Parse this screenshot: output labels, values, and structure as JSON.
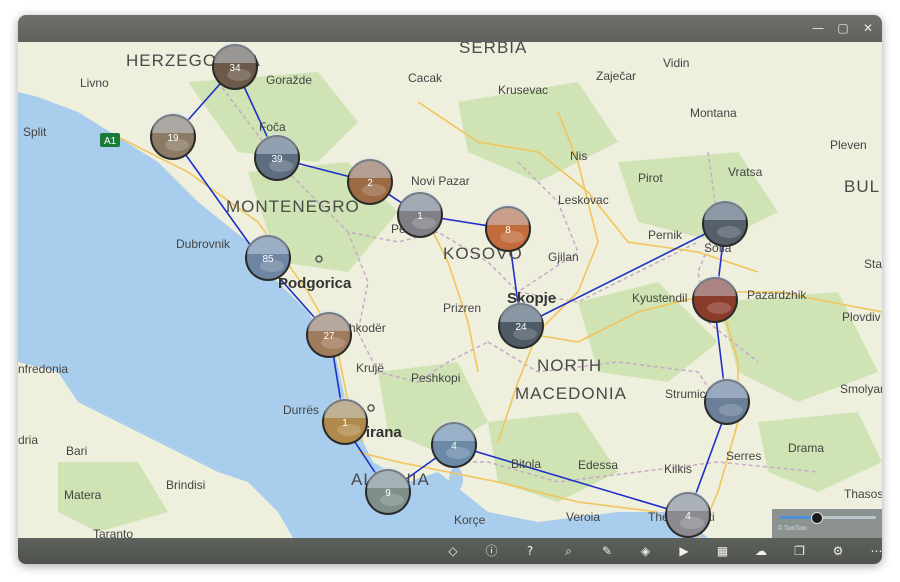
{
  "window": {
    "controls": {
      "minimize": "—",
      "maximize": "▢",
      "close": "✕"
    }
  },
  "map": {
    "countries": [
      {
        "id": "serbia",
        "label": "SERBIA"
      },
      {
        "id": "herzegovina",
        "label": "HERZEGOVINA"
      },
      {
        "id": "montenegro",
        "label": "MONTENEGRO"
      },
      {
        "id": "kosovo",
        "label": "KOSOVO"
      },
      {
        "id": "north",
        "label": "NORTH"
      },
      {
        "id": "macedonia",
        "label": "MACEDONIA"
      },
      {
        "id": "albania",
        "label": "ALBANIA"
      },
      {
        "id": "bulgaria",
        "label": "BUL"
      }
    ],
    "cities": [
      {
        "id": "livno",
        "label": "Livno"
      },
      {
        "id": "split",
        "label": "Split"
      },
      {
        "id": "gorazde",
        "label": "Goražde"
      },
      {
        "id": "foca",
        "label": "Foča"
      },
      {
        "id": "cacak",
        "label": "Cacak"
      },
      {
        "id": "krusevac",
        "label": "Krusevac"
      },
      {
        "id": "zajecar",
        "label": "Zaječar"
      },
      {
        "id": "vidin",
        "label": "Vidin"
      },
      {
        "id": "montana",
        "label": "Montana"
      },
      {
        "id": "pleven",
        "label": "Pleven"
      },
      {
        "id": "nis",
        "label": "Nis"
      },
      {
        "id": "pirot",
        "label": "Pirot"
      },
      {
        "id": "vratsa",
        "label": "Vratsa"
      },
      {
        "id": "novipazar",
        "label": "Novi Pazar"
      },
      {
        "id": "leskovac",
        "label": "Leskovac"
      },
      {
        "id": "dubrovnik",
        "label": "Dubrovnik"
      },
      {
        "id": "pec",
        "label": "Peć"
      },
      {
        "id": "gjilan",
        "label": "Gjilan"
      },
      {
        "id": "pernik",
        "label": "Pernik"
      },
      {
        "id": "sofia",
        "label": "Sofia"
      },
      {
        "id": "sta",
        "label": "Sta"
      },
      {
        "id": "prizren",
        "label": "Prizren"
      },
      {
        "id": "kyustendil",
        "label": "Kyustendil"
      },
      {
        "id": "pazardzhik",
        "label": "Pazardzhik"
      },
      {
        "id": "plovdiv",
        "label": "Plovdiv"
      },
      {
        "id": "shkoder",
        "label": "Shkodër"
      },
      {
        "id": "kruje",
        "label": "Krujë"
      },
      {
        "id": "peshkopi",
        "label": "Peshkopi"
      },
      {
        "id": "smolyan",
        "label": "Smolyan"
      },
      {
        "id": "manfredonia",
        "label": "nfredonia"
      },
      {
        "id": "strumica",
        "label": "Strumica"
      },
      {
        "id": "durres",
        "label": "Durrës"
      },
      {
        "id": "tirana",
        "label": "Tirana"
      },
      {
        "id": "adria",
        "label": "dria"
      },
      {
        "id": "bari",
        "label": "Bari"
      },
      {
        "id": "serres",
        "label": "Serres"
      },
      {
        "id": "drama",
        "label": "Drama"
      },
      {
        "id": "brindisi",
        "label": "Brindisi"
      },
      {
        "id": "bitola",
        "label": "Bitola"
      },
      {
        "id": "edessa",
        "label": "Edessa"
      },
      {
        "id": "kilkis",
        "label": "Kilkis"
      },
      {
        "id": "matera",
        "label": "Matera"
      },
      {
        "id": "thasos",
        "label": "Thasos"
      },
      {
        "id": "korce",
        "label": "Korçe"
      },
      {
        "id": "veroia",
        "label": "Veroia"
      },
      {
        "id": "thessaloniki",
        "label": "Thessaloniki"
      },
      {
        "id": "taranto",
        "label": "Taranto"
      }
    ],
    "capitals": [
      {
        "id": "podgorica",
        "label": "Podgorica"
      },
      {
        "id": "skopje",
        "label": "Skopje"
      }
    ],
    "road_shield": "A1",
    "route_color": "#1f2fc9",
    "photo_clusters": [
      {
        "id": "c1",
        "count": "34"
      },
      {
        "id": "c2",
        "count": "19"
      },
      {
        "id": "c3",
        "count": "39"
      },
      {
        "id": "c4",
        "count": "2"
      },
      {
        "id": "c5",
        "count": "1"
      },
      {
        "id": "c6",
        "count": "8"
      },
      {
        "id": "c7",
        "count": "85"
      },
      {
        "id": "c8",
        "count": "27"
      },
      {
        "id": "c9",
        "count": "24"
      },
      {
        "id": "c10",
        "count": "1"
      },
      {
        "id": "c11",
        "count": "4"
      },
      {
        "id": "c12",
        "count": "9"
      },
      {
        "id": "c13",
        "count": "4"
      },
      {
        "id": "c14",
        "count": ""
      },
      {
        "id": "c15",
        "count": ""
      },
      {
        "id": "c16",
        "count": ""
      }
    ]
  },
  "zoom": {
    "level": 0.38,
    "credit": "© TomTom"
  },
  "toolbar": {
    "items": [
      {
        "id": "favorite",
        "icon": "diamond-icon",
        "glyph": "◇"
      },
      {
        "id": "info",
        "icon": "info-icon",
        "glyph": "ⓘ"
      },
      {
        "id": "help",
        "icon": "help-icon",
        "glyph": "?"
      },
      {
        "id": "search",
        "icon": "search-icon",
        "glyph": "⌕"
      },
      {
        "id": "edit",
        "icon": "edit-icon",
        "glyph": "✎"
      },
      {
        "id": "layers",
        "icon": "layers-icon",
        "glyph": "◈"
      },
      {
        "id": "play",
        "icon": "play-icon",
        "glyph": "▶"
      },
      {
        "id": "grid",
        "icon": "grid-icon",
        "glyph": "▦"
      },
      {
        "id": "cloud",
        "icon": "cloud-icon",
        "glyph": "☁"
      },
      {
        "id": "albums",
        "icon": "albums-icon",
        "glyph": "❐"
      },
      {
        "id": "settings",
        "icon": "gear-icon",
        "glyph": "⚙"
      },
      {
        "id": "more",
        "icon": "more-icon",
        "glyph": "⋯"
      }
    ]
  }
}
